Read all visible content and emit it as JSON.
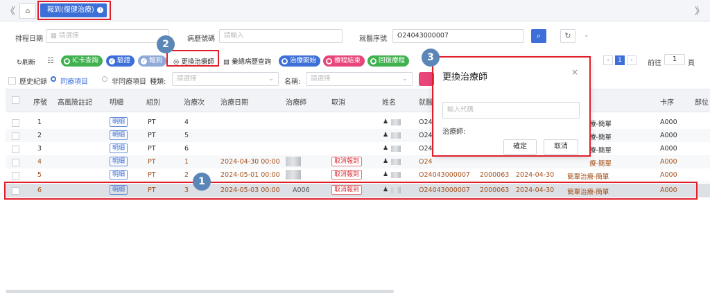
{
  "tabs": {
    "active": "報到(復健治療)",
    "info_icon": "info-icon"
  },
  "filters": {
    "date_label": "排程日期",
    "date_placeholder": "請選擇",
    "chart_label": "病歷號碼",
    "chart_placeholder": "請輸入",
    "visit_label": "就醫序號",
    "visit_value": "O24043000007"
  },
  "toolbar": {
    "refresh": "刷新",
    "ic_query": "IC卡查詢",
    "verify": "驗證",
    "checkin": "報到",
    "change_therapist": "更換治療師",
    "history_query": "彙總病歷查詢",
    "start_treatment": "治療開始",
    "end_course": "療程結束",
    "restore_course": "回復療程"
  },
  "options": {
    "history": "歷史紀錄",
    "same_course": "同療項目",
    "other_course": "非同療項目",
    "type_label": "種類:",
    "type_placeholder": "請選擇",
    "name_label": "名稱:",
    "name_placeholder": "請選擇"
  },
  "pagination": {
    "current": "1",
    "goto_label": "前往",
    "goto_value": "1",
    "page_suffix": "頁"
  },
  "table": {
    "headers": [
      "序號",
      "高風險註記",
      "明細",
      "組別",
      "治療次",
      "治療日期",
      "治療師",
      "取消",
      "姓名",
      "就醫",
      "",
      "",
      "",
      "卡序",
      "部位"
    ],
    "detail_label": "明細",
    "cancel_label": "取消報到",
    "rows": [
      {
        "no": "1",
        "group": "PT",
        "count": "4",
        "date": "",
        "therapist": "",
        "cancel": false,
        "visit": "O24",
        "card": "A000",
        "item": "療-簡單",
        "code": "",
        "date2": "",
        "color": "normal"
      },
      {
        "no": "2",
        "group": "PT",
        "count": "5",
        "date": "",
        "therapist": "",
        "cancel": false,
        "visit": "O24",
        "card": "A000",
        "item": "療-簡單",
        "code": "",
        "date2": "",
        "color": "normal"
      },
      {
        "no": "3",
        "group": "PT",
        "count": "6",
        "date": "",
        "therapist": "",
        "cancel": false,
        "visit": "O24",
        "card": "A000",
        "item": "療-簡單",
        "code": "",
        "date2": "",
        "color": "normal"
      },
      {
        "no": "4",
        "group": "PT",
        "count": "1",
        "date": "2024-04-30 00:00",
        "therapist": "",
        "cancel": true,
        "visit": "O24",
        "card": "A000",
        "item": "療-簡單",
        "code": "",
        "date2": "",
        "color": "orange"
      },
      {
        "no": "5",
        "group": "PT",
        "count": "2",
        "date": "2024-05-01 00:00",
        "therapist": "",
        "cancel": true,
        "visit": "O24043000007",
        "card": "A000",
        "item": "簡單治療-簡單",
        "code": "2000063",
        "date2": "2024-04-30",
        "color": "orange"
      },
      {
        "no": "6",
        "group": "PT",
        "count": "3",
        "date": "2024-05-03 00:00",
        "therapist": "A006",
        "cancel": true,
        "visit": "O24043000007",
        "card": "A000",
        "item": "簡單治療-簡單",
        "code": "2000063",
        "date2": "2024-04-30",
        "color": "orange"
      }
    ]
  },
  "dialog": {
    "title": "更換治療師",
    "input_placeholder": "輸入代碼",
    "therapist_label": "治療師:",
    "confirm": "確定",
    "cancel": "取消",
    "close_icon": "close-icon"
  },
  "markers": {
    "m1": "1",
    "m2": "2",
    "m3": "3"
  },
  "colors": {
    "primary": "#3c6fd8",
    "highlight": "#e01e2a",
    "marker": "#5b86b8",
    "green": "#3fb24f",
    "pink": "#e8457a"
  }
}
